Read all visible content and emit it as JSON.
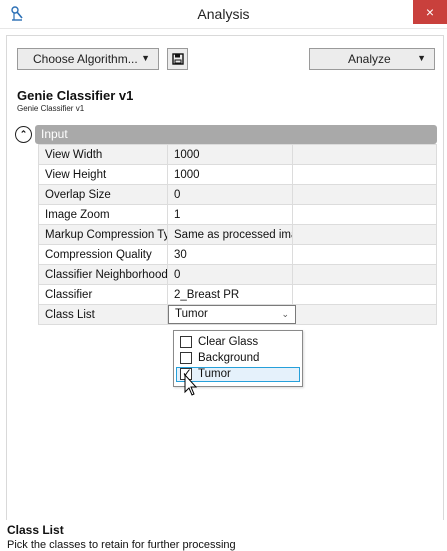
{
  "window": {
    "title": "Analysis",
    "close_glyph": "×"
  },
  "toolbar": {
    "choose_algorithm_label": "Choose Algorithm...",
    "save_icon": "save-icon",
    "analyze_label": "Analyze"
  },
  "algorithm": {
    "name": "Genie Classifier v1",
    "subtitle": "Genie Classifier v1"
  },
  "section": {
    "title": "Input",
    "collapse_glyph": "⌃"
  },
  "properties": [
    {
      "name": "View Width",
      "value": "1000"
    },
    {
      "name": "View Height",
      "value": "1000"
    },
    {
      "name": "Overlap Size",
      "value": "0"
    },
    {
      "name": "Image Zoom",
      "value": "1"
    },
    {
      "name": "Markup Compression Type",
      "value": "Same as processed image"
    },
    {
      "name": "Compression Quality",
      "value": "30"
    },
    {
      "name": "Classifier Neighborhood",
      "value": "0"
    },
    {
      "name": "Classifier",
      "value": "2_Breast PR"
    },
    {
      "name": "Class List",
      "value": "Tumor"
    }
  ],
  "class_list_options": [
    {
      "label": "Clear Glass",
      "checked": false
    },
    {
      "label": "Background",
      "checked": false
    },
    {
      "label": "Tumor",
      "checked": true
    }
  ],
  "description": {
    "title": "Class List",
    "text": "Pick the classes to retain for further processing"
  },
  "colors": {
    "close_button": "#c9403c",
    "section_header": "#a9a9a9",
    "highlight_border": "#26a0da",
    "highlight_fill": "#e5f1fb"
  }
}
